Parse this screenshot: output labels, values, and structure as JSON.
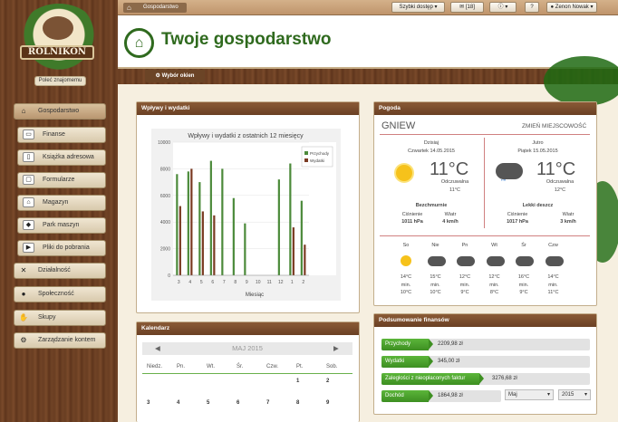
{
  "logo": {
    "text": "ROLNIKON"
  },
  "recommend_label": "Poleć znajomemu",
  "nav": [
    {
      "label": "Gospodarstwo",
      "icon": "home-icon",
      "glyph": "⌂",
      "active": true
    },
    {
      "label": "Finanse",
      "icon": "finance-icon",
      "glyph": "▭",
      "sub": true
    },
    {
      "label": "Książka adresowa",
      "icon": "address-book-icon",
      "glyph": "▯",
      "sub": true
    },
    {
      "label": "Formularze",
      "icon": "forms-icon",
      "glyph": "▢",
      "sub": true
    },
    {
      "label": "Magazyn",
      "icon": "warehouse-icon",
      "glyph": "⌂",
      "sub": true
    },
    {
      "label": "Park maszyn",
      "icon": "tractor-icon",
      "glyph": "◆",
      "sub": true
    },
    {
      "label": "Pliki do pobrania",
      "icon": "play-icon",
      "glyph": "▶",
      "sub": true
    },
    {
      "label": "Działalność",
      "icon": "tools-icon",
      "glyph": "✕"
    },
    {
      "label": "Społeczność",
      "icon": "people-icon",
      "glyph": "●"
    },
    {
      "label": "Skupy",
      "icon": "handshake-icon",
      "glyph": "✋"
    },
    {
      "label": "Zarządzanie kontem",
      "icon": "gear-icon",
      "glyph": "⚙"
    }
  ],
  "topbar": {
    "breadcrumb": "Gospodarstwo",
    "quick_access": "Szybki dostęp",
    "messages": "18",
    "user": "Zenon Nowak"
  },
  "header": {
    "title": "Twoje gospodarstwo",
    "choose_windows": "Wybór okien"
  },
  "flows_panel": {
    "title": "Wpływy i wydatki"
  },
  "chart_data": {
    "type": "bar",
    "title": "Wpływy i wydatki z ostatnich 12 miesięcy",
    "xlabel": "Miesiąc",
    "ylabel": "",
    "ylim": [
      0,
      10000
    ],
    "yticks": [
      "0",
      "2000",
      "4000",
      "6000",
      "8000",
      "10000"
    ],
    "categories": [
      "3",
      "4",
      "5",
      "6",
      "7",
      "8",
      "9",
      "10",
      "11",
      "12",
      "1",
      "2"
    ],
    "legend_position": "top-right",
    "series": [
      {
        "name": "Przychody",
        "color": "#4c8a3a",
        "values": [
          7600,
          7800,
          7000,
          8600,
          8000,
          5800,
          3900,
          0,
          0,
          7200,
          8400,
          5600
        ]
      },
      {
        "name": "Wydatki",
        "color": "#7a3a22",
        "values": [
          5200,
          8000,
          4800,
          4500,
          0,
          0,
          0,
          0,
          0,
          0,
          3600,
          2300
        ]
      }
    ]
  },
  "weather": {
    "title": "Pogoda",
    "city": "GNIEW",
    "change_label": "ZMIEŃ MIEJSCOWOŚĆ",
    "today": {
      "label": "Dzisiaj",
      "date": "Czwartek 14.05.2015",
      "temp": "11°C",
      "feels_label": "Odczuwalna",
      "feels": "11°C",
      "desc": "Bezchmurnie",
      "pressure_label": "Ciśnienie",
      "pressure": "1011 hPa",
      "wind_label": "Wiatr",
      "wind": "4 km/h"
    },
    "tomorrow": {
      "label": "Jutro",
      "date": "Piątek 15.05.2015",
      "temp": "11°C",
      "feels_label": "Odczuwalna",
      "feels": "12°C",
      "desc": "Lekki deszcz",
      "pressure_label": "Ciśnienie",
      "pressure": "1017 hPa",
      "wind_label": "Wiatr",
      "wind": "3 km/h"
    },
    "forecast": [
      {
        "day": "So",
        "icon": "sun-icon",
        "max": "14°C",
        "min_label": "min.",
        "min": "10°C"
      },
      {
        "day": "Nie",
        "icon": "storm-icon",
        "max": "15°C",
        "min_label": "min.",
        "min": "10°C"
      },
      {
        "day": "Pn",
        "icon": "storm-icon",
        "max": "12°C",
        "min_label": "min.",
        "min": "9°C"
      },
      {
        "day": "Wt",
        "icon": "storm-icon",
        "max": "12°C",
        "min_label": "min.",
        "min": "8°C"
      },
      {
        "day": "Śr",
        "icon": "storm-icon",
        "max": "16°C",
        "min_label": "min.",
        "min": "9°C"
      },
      {
        "day": "Czw",
        "icon": "storm-icon",
        "max": "14°C",
        "min_label": "min.",
        "min": "11°C"
      }
    ]
  },
  "calendar": {
    "title": "Kalendarz",
    "month": "MAJ 2015",
    "days": [
      "Niedz.",
      "Pn.",
      "Wt.",
      "Śr.",
      "Czw.",
      "Pt.",
      "Sob."
    ],
    "week1": [
      "",
      "",
      "",
      "",
      "",
      "1",
      "2"
    ],
    "week2": [
      "3",
      "4",
      "5",
      "6",
      "7",
      "8",
      "9"
    ]
  },
  "finance": {
    "title": "Podsumowanie finansów",
    "rows": [
      {
        "label": "Przychody",
        "value": "2209,98 zł"
      },
      {
        "label": "Wydatki",
        "value": "345,00 zł"
      },
      {
        "label": "Zaległości z nieopłaconych faktur",
        "value": "3276,68 zł"
      },
      {
        "label": "Dochód",
        "value": "1864,98 zł"
      }
    ],
    "month_select": "Maj",
    "year_select": "2015"
  }
}
